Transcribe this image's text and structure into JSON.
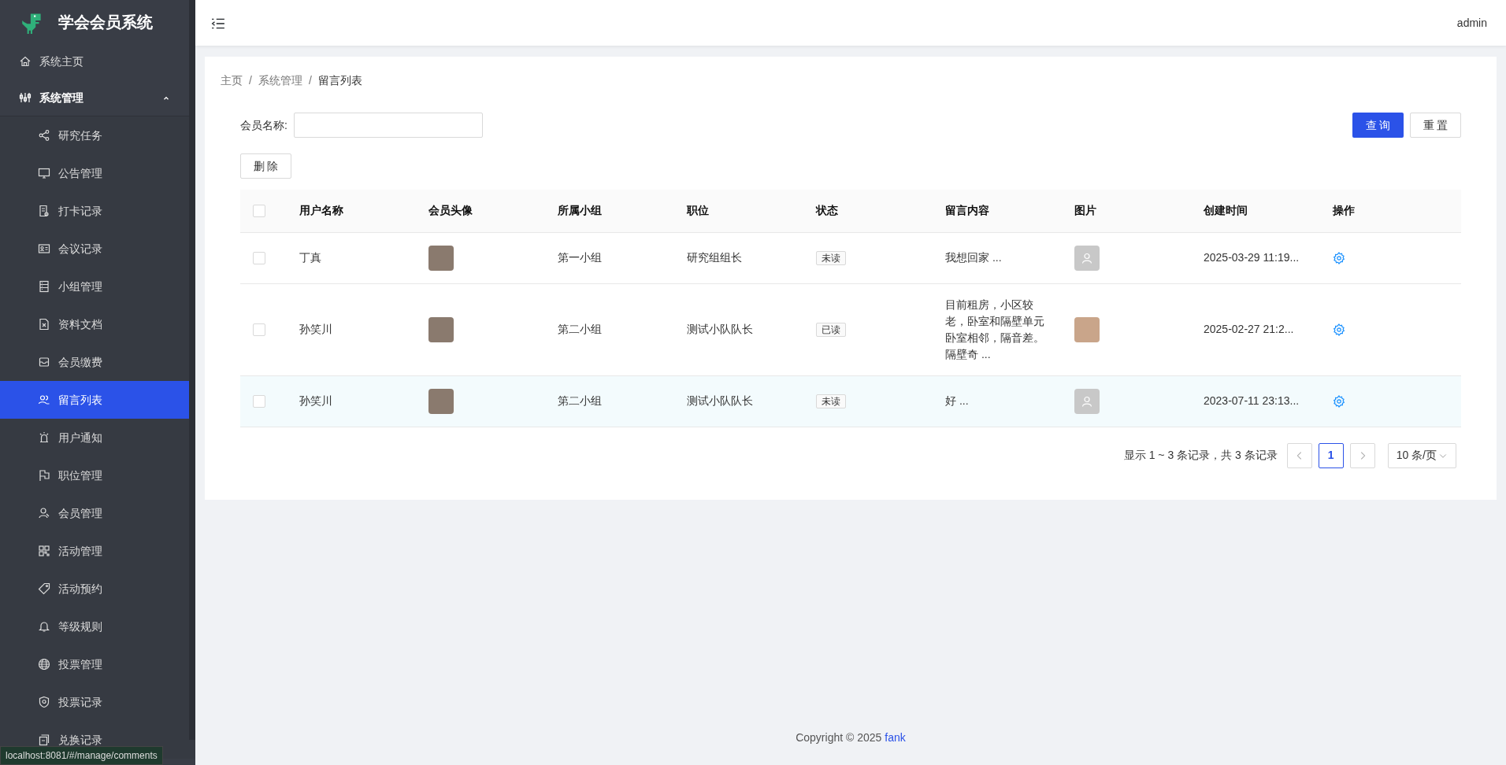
{
  "sidebar": {
    "logo_text": "学会会员系统",
    "items": [
      {
        "label": "系统主页",
        "selected": false
      },
      {
        "label": "系统管理",
        "selected": false,
        "expanded": true,
        "children": [
          {
            "label": "研究任务",
            "selected": false
          },
          {
            "label": "公告管理",
            "selected": false
          },
          {
            "label": "打卡记录",
            "selected": false
          },
          {
            "label": "会议记录",
            "selected": false
          },
          {
            "label": "小组管理",
            "selected": false
          },
          {
            "label": "资料文档",
            "selected": false
          },
          {
            "label": "会员缴费",
            "selected": false
          },
          {
            "label": "留言列表",
            "selected": true
          },
          {
            "label": "用户通知",
            "selected": false
          },
          {
            "label": "职位管理",
            "selected": false
          },
          {
            "label": "会员管理",
            "selected": false
          },
          {
            "label": "活动管理",
            "selected": false
          },
          {
            "label": "活动预约",
            "selected": false
          },
          {
            "label": "等级规则",
            "selected": false
          },
          {
            "label": "投票管理",
            "selected": false
          },
          {
            "label": "投票记录",
            "selected": false
          },
          {
            "label": "兑换记录",
            "selected": false
          }
        ]
      }
    ]
  },
  "header": {
    "user": "admin"
  },
  "breadcrumb": [
    {
      "text": "主页",
      "kind": "link"
    },
    {
      "text": "/",
      "kind": "separator"
    },
    {
      "text": "系统管理",
      "kind": "link"
    },
    {
      "text": "/",
      "kind": "separator"
    },
    {
      "text": "留言列表",
      "kind": "current"
    }
  ],
  "search": {
    "label": "会员名称:",
    "query_button": "查 询",
    "reset_button": "重 置"
  },
  "delete_button": "删 除",
  "table": {
    "header_checked": false,
    "columns": [
      "用户名称",
      "会员头像",
      "所属小组",
      "职位",
      "状态",
      "留言内容",
      "图片",
      "创建时间",
      "操作"
    ],
    "rows": [
      {
        "checked": false,
        "highlighted": false,
        "user": "丁真",
        "group": "第一小组",
        "position": "研究组组长",
        "status": "未读",
        "content": "我想回家 ...",
        "has_photo": false,
        "created": "2025-03-29 11:19..."
      },
      {
        "checked": false,
        "highlighted": false,
        "user": "孙笑川",
        "group": "第二小组",
        "position": "测试小队队长",
        "status": "已读",
        "content": "目前租房，小区较老，卧室和隔壁单元卧室相邻，隔音差。隔壁奇 ...",
        "has_photo": true,
        "created": "2025-02-27 21:2..."
      },
      {
        "checked": false,
        "highlighted": true,
        "user": "孙笑川",
        "group": "第二小组",
        "position": "测试小队队长",
        "status": "未读",
        "content": "好 ...",
        "has_photo": false,
        "created": "2023-07-11 23:13..."
      }
    ]
  },
  "pagination": {
    "summary": "显示 1 ~ 3 条记录，共 3 条记录",
    "pages": [
      {
        "label": "1",
        "selected": true
      }
    ],
    "page_size": "10 条/页"
  },
  "footer": {
    "text": "Copyright © 2025",
    "link": "fank"
  },
  "status_url": "localhost:8081/#/manage/comments"
}
